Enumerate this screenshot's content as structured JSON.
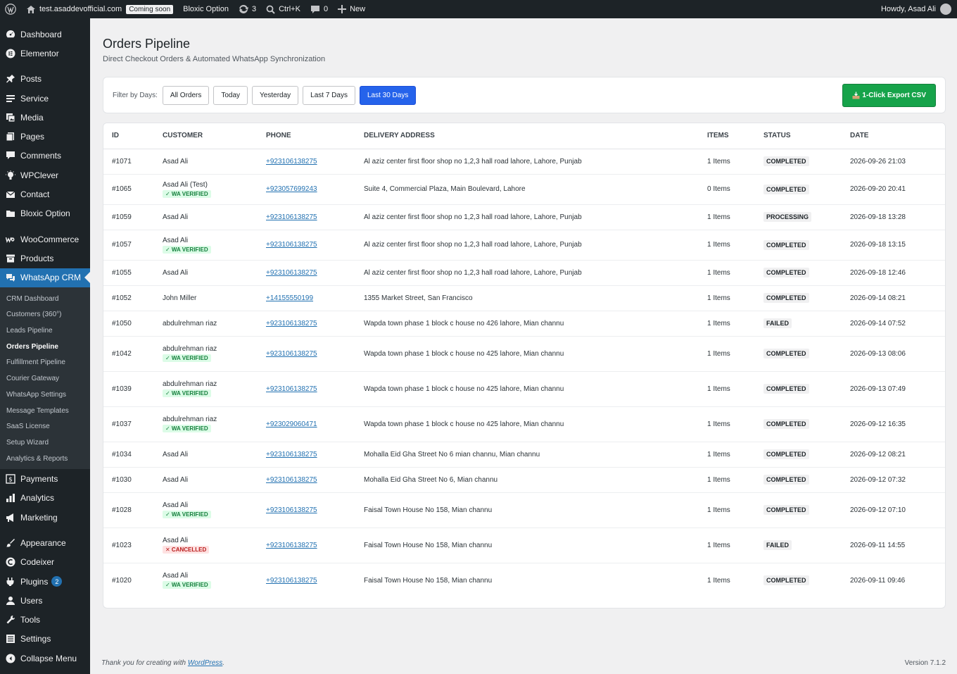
{
  "adminbar": {
    "site": "test.asaddevofficial.com",
    "coming_soon": "Coming soon",
    "bloxic": "Bloxic Option",
    "updates": "3",
    "search": "Ctrl+K",
    "comments": "0",
    "new": "New",
    "howdy": "Howdy, Asad Ali"
  },
  "sidebar": {
    "items": [
      "Dashboard",
      "Elementor",
      "Posts",
      "Service",
      "Media",
      "Pages",
      "Comments",
      "WPClever",
      "Contact",
      "Bloxic Option",
      "WooCommerce",
      "Products",
      "WhatsApp CRM"
    ],
    "submenu": [
      "CRM Dashboard",
      "Customers (360°)",
      "Leads Pipeline",
      "Orders Pipeline",
      "Fulfillment Pipeline",
      "Courier Gateway",
      "WhatsApp Settings",
      "Message Templates",
      "SaaS License",
      "Setup Wizard",
      "Analytics & Reports"
    ],
    "after": [
      "Payments",
      "Analytics",
      "Marketing",
      "Appearance",
      "Codeixer",
      "Plugins",
      "Users",
      "Tools",
      "Settings",
      "Collapse Menu"
    ],
    "plugins_badge": "2"
  },
  "page": {
    "title": "Orders Pipeline",
    "subtitle": "Direct Checkout Orders & Automated WhatsApp Synchronization"
  },
  "filter": {
    "label": "Filter by Days:",
    "buttons": [
      "All Orders",
      "Today",
      "Yesterday",
      "Last 7 Days",
      "Last 30 Days"
    ],
    "active": "Last 30 Days",
    "export": "1-Click Export CSV"
  },
  "table": {
    "headers": [
      "ID",
      "CUSTOMER",
      "PHONE",
      "DELIVERY ADDRESS",
      "ITEMS",
      "STATUS",
      "DATE"
    ],
    "rows": [
      {
        "id": "#1071",
        "customer": "Asad Ali",
        "tag": "",
        "phone": "+923106138275",
        "address": "Al aziz center first floor shop no 1,2,3 hall road lahore, Lahore, Punjab",
        "items": "1 Items",
        "status": "COMPLETED",
        "date": "2026-09-26 21:03"
      },
      {
        "id": "#1065",
        "customer": "Asad Ali (Test)",
        "tag": "✓ WA VERIFIED",
        "phone": "+923057699243",
        "address": "Suite 4, Commercial Plaza, Main Boulevard, Lahore",
        "items": "0 Items",
        "status": "COMPLETED",
        "date": "2026-09-20 20:41"
      },
      {
        "id": "#1059",
        "customer": "Asad Ali",
        "tag": "",
        "phone": "+923106138275",
        "address": "Al aziz center first floor shop no 1,2,3 hall road lahore, Lahore, Punjab",
        "items": "1 Items",
        "status": "PROCESSING",
        "date": "2026-09-18 13:28"
      },
      {
        "id": "#1057",
        "customer": "Asad Ali",
        "tag": "✓ WA VERIFIED",
        "phone": "+923106138275",
        "address": "Al aziz center first floor shop no 1,2,3 hall road lahore, Lahore, Punjab",
        "items": "1 Items",
        "status": "COMPLETED",
        "date": "2026-09-18 13:15"
      },
      {
        "id": "#1055",
        "customer": "Asad Ali",
        "tag": "",
        "phone": "+923106138275",
        "address": "Al aziz center first floor shop no 1,2,3 hall road lahore, Lahore, Punjab",
        "items": "1 Items",
        "status": "COMPLETED",
        "date": "2026-09-18 12:46"
      },
      {
        "id": "#1052",
        "customer": "John Miller",
        "tag": "",
        "phone": "+14155550199",
        "address": "1355 Market Street, San Francisco",
        "items": "1 Items",
        "status": "COMPLETED",
        "date": "2026-09-14 08:21"
      },
      {
        "id": "#1050",
        "customer": "abdulrehman riaz",
        "tag": "",
        "phone": "+923106138275",
        "address": "Wapda town phase 1 block c house no 426 lahore, Mian channu",
        "items": "1 Items",
        "status": "FAILED",
        "date": "2026-09-14 07:52"
      },
      {
        "id": "#1042",
        "customer": "abdulrehman riaz",
        "tag": "✓ WA VERIFIED",
        "phone": "+923106138275",
        "address": "Wapda town phase 1 block c house no 425 lahore, Mian channu",
        "items": "1 Items",
        "status": "COMPLETED",
        "date": "2026-09-13 08:06"
      },
      {
        "id": "#1039",
        "customer": "abdulrehman riaz",
        "tag": "✓ WA VERIFIED",
        "phone": "+923106138275",
        "address": "Wapda town phase 1 block c house no 425 lahore, Mian channu",
        "items": "1 Items",
        "status": "COMPLETED",
        "date": "2026-09-13 07:49"
      },
      {
        "id": "#1037",
        "customer": "abdulrehman riaz",
        "tag": "✓ WA VERIFIED",
        "phone": "+923029060471",
        "address": "Wapda town phase 1 block c house no 425 lahore, Mian channu",
        "items": "1 Items",
        "status": "COMPLETED",
        "date": "2026-09-12 16:35"
      },
      {
        "id": "#1034",
        "customer": "Asad Ali",
        "tag": "",
        "phone": "+923106138275",
        "address": "Mohalla Eid Gha Street No 6 mian channu, Mian channu",
        "items": "1 Items",
        "status": "COMPLETED",
        "date": "2026-09-12 08:21"
      },
      {
        "id": "#1030",
        "customer": "Asad Ali",
        "tag": "",
        "phone": "+923106138275",
        "address": "Mohalla Eid Gha Street No 6, Mian channu",
        "items": "1 Items",
        "status": "COMPLETED",
        "date": "2026-09-12 07:32"
      },
      {
        "id": "#1028",
        "customer": "Asad Ali",
        "tag": "✓ WA VERIFIED",
        "phone": "+923106138275",
        "address": "Faisal Town House No 158, Mian channu",
        "items": "1 Items",
        "status": "COMPLETED",
        "date": "2026-09-12 07:10"
      },
      {
        "id": "#1023",
        "customer": "Asad Ali",
        "tag": "✕ CANCELLED",
        "phone": "+923106138275",
        "address": "Faisal Town House No 158, Mian channu",
        "items": "1 Items",
        "status": "FAILED",
        "date": "2026-09-11 14:55"
      },
      {
        "id": "#1020",
        "customer": "Asad Ali",
        "tag": "✓ WA VERIFIED",
        "phone": "+923106138275",
        "address": "Faisal Town House No 158, Mian channu",
        "items": "1 Items",
        "status": "COMPLETED",
        "date": "2026-09-11 09:46"
      }
    ]
  },
  "footer": {
    "thanks": "Thank you for creating with ",
    "wordpress": "WordPress",
    "period": ".",
    "version": "Version 7.1.2"
  },
  "colors": {
    "accent": "#2271b1",
    "active_filter": "#2563eb",
    "export": "#16a34a",
    "sidebar": "#1d2327"
  }
}
